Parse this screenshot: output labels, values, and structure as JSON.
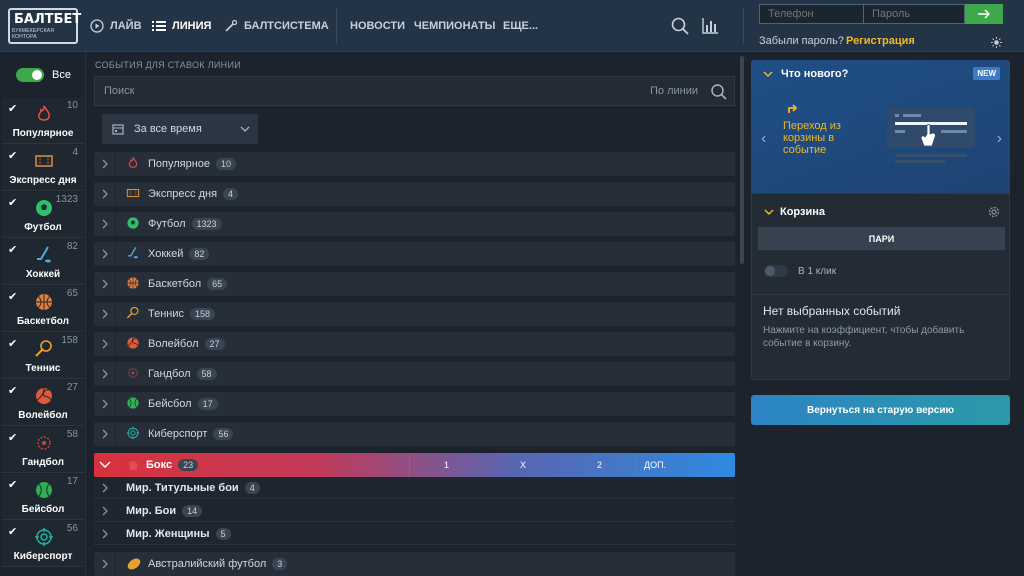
{
  "header": {
    "logo_top": "БАЛТБЕТ",
    "logo_bottom": "БУКМЕКЕРСКАЯ КОНТОРА",
    "nav": {
      "live": "ЛАЙВ",
      "line": "ЛИНИЯ",
      "baltsystem": "БАЛТСИСТЕМА",
      "news": "НОВОСТИ",
      "championships": "ЧЕМПИОНАТЫ",
      "more": "ЕЩЕ..."
    },
    "phone_placeholder": "Телефон",
    "password_placeholder": "Пароль",
    "forgot": "Забыли пароль?",
    "register": "Регистрация"
  },
  "sidebar": {
    "all_label": "Все",
    "items": [
      {
        "name": "Популярное",
        "count": "10",
        "icon": "fire-icon",
        "color": "#e24d4d"
      },
      {
        "name": "Экспресс дня",
        "count": "4",
        "icon": "ticket-icon",
        "color": "#e08a3a"
      },
      {
        "name": "Футбол",
        "count": "1323",
        "icon": "football-icon",
        "color": "#2fbf6a"
      },
      {
        "name": "Хоккей",
        "count": "82",
        "icon": "hockey-icon",
        "color": "#4fa8e0"
      },
      {
        "name": "Баскетбол",
        "count": "65",
        "icon": "basketball-icon",
        "color": "#e57a3a"
      },
      {
        "name": "Теннис",
        "count": "158",
        "icon": "tennis-icon",
        "color": "#f0a030"
      },
      {
        "name": "Волейбол",
        "count": "27",
        "icon": "volleyball-icon",
        "color": "#e05a3a"
      },
      {
        "name": "Гандбол",
        "count": "58",
        "icon": "handball-icon",
        "color": "#d04040"
      },
      {
        "name": "Бейсбол",
        "count": "17",
        "icon": "baseball-icon",
        "color": "#2fb050"
      },
      {
        "name": "Киберспорт",
        "count": "56",
        "icon": "esports-icon",
        "color": "#22b0a0"
      }
    ]
  },
  "main": {
    "section_title": "СОБЫТИЯ ДЛЯ СТАВОК ЛИНИИ",
    "search_placeholder": "Поиск",
    "search_scope": "По линии",
    "period": "За все время",
    "categories": [
      {
        "name": "Популярное",
        "count": "10"
      },
      {
        "name": "Экспресс дня",
        "count": "4"
      },
      {
        "name": "Футбол",
        "count": "1323"
      },
      {
        "name": "Хоккей",
        "count": "82"
      },
      {
        "name": "Баскетбол",
        "count": "65"
      },
      {
        "name": "Теннис",
        "count": "158"
      },
      {
        "name": "Волейбол",
        "count": "27"
      },
      {
        "name": "Гандбол",
        "count": "58"
      },
      {
        "name": "Бейсбол",
        "count": "17"
      },
      {
        "name": "Киберспорт",
        "count": "56"
      }
    ],
    "expanded": {
      "name": "Бокс",
      "count": "23",
      "col1": "1",
      "colx": "X",
      "col2": "2",
      "colmore": "ДОП.",
      "subs": [
        {
          "name": "Мир. Титульные бои",
          "count": "4"
        },
        {
          "name": "Мир. Бои",
          "count": "14"
        },
        {
          "name": "Мир. Женщины",
          "count": "5"
        }
      ]
    },
    "last": {
      "name": "Австралийский футбол",
      "count": "3"
    }
  },
  "right": {
    "news_title": "Что нового?",
    "news_badge": "NEW",
    "news_text": "Переход из корзины в событие",
    "cart_title": "Корзина",
    "cart_tab": "ПАРИ",
    "one_click": "В 1 клик",
    "empty_title": "Нет выбранных событий",
    "empty_text": "Нажмите на коэффициент, чтобы добавить событие в корзину.",
    "old_version": "Вернуться на старую версию"
  }
}
